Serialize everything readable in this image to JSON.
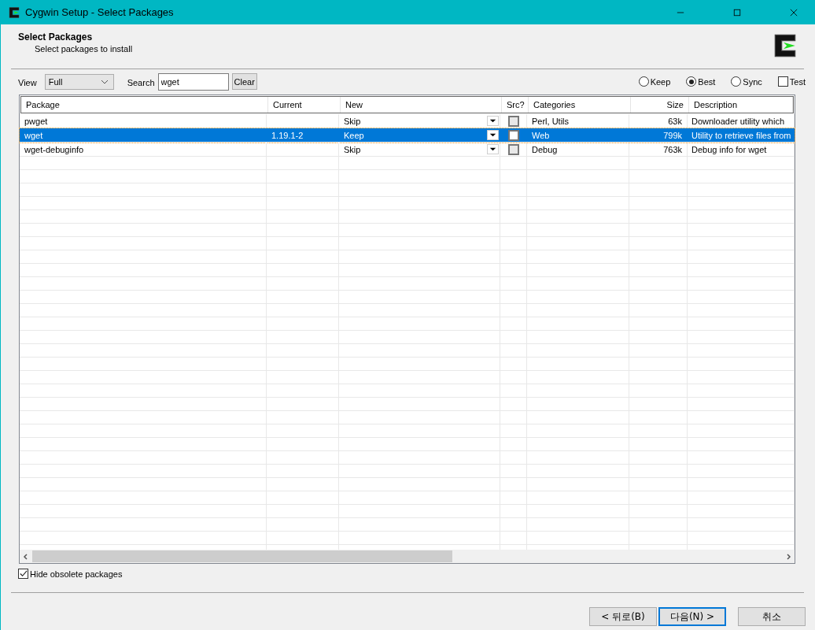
{
  "window": {
    "title": "Cygwin Setup - Select Packages"
  },
  "header": {
    "title": "Select Packages",
    "subtitle": "Select packages to install"
  },
  "toolbar": {
    "view_label": "View",
    "view_value": "Full",
    "search_label": "Search",
    "search_value": "wget",
    "clear_button": "Clear",
    "modes": [
      {
        "label": "Keep",
        "selected": false
      },
      {
        "label": "Best",
        "selected": true
      },
      {
        "label": "Sync",
        "selected": false
      }
    ],
    "test": {
      "label": "Test",
      "checked": false
    }
  },
  "table": {
    "columns": [
      "Package",
      "Current",
      "New",
      "Src?",
      "Categories",
      "Size",
      "Description"
    ],
    "rows": [
      {
        "package": "pwget",
        "current": "",
        "new": "Skip",
        "src": false,
        "categories": "Perl, Utils",
        "size": "63k",
        "description": "Downloader utility which",
        "selected": false
      },
      {
        "package": "wget",
        "current": "1.19.1-2",
        "new": "Keep",
        "src": false,
        "categories": "Web",
        "size": "799k",
        "description": "Utility to retrieve files from",
        "selected": true
      },
      {
        "package": "wget-debuginfo",
        "current": "",
        "new": "Skip",
        "src": false,
        "categories": "Debug",
        "size": "763k",
        "description": "Debug info for wget",
        "selected": false
      }
    ]
  },
  "hide_obsolete": {
    "label": "Hide obsolete packages",
    "checked": true
  },
  "buttons": [
    {
      "label": "< 뒤로(B)",
      "focused": false
    },
    {
      "label": "다음(N) >",
      "focused": true
    },
    {
      "label": "취소",
      "focused": false
    }
  ]
}
